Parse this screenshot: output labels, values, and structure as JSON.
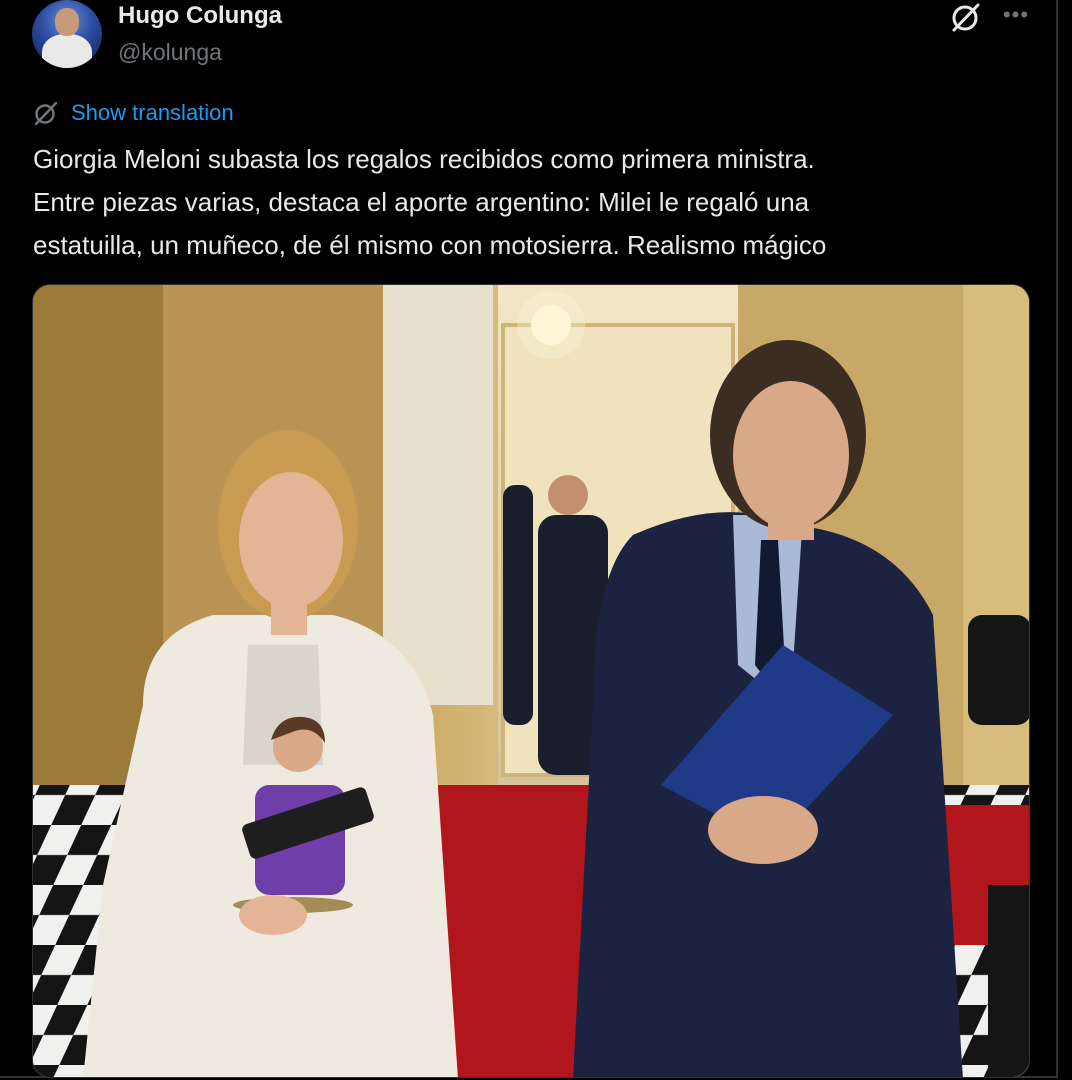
{
  "author": {
    "name": "Hugo Colunga",
    "handle": "@kolunga"
  },
  "icons": {
    "grok": "grok-icon",
    "more": "more-icon",
    "translate": "translate-icon"
  },
  "translation_link": "Show translation",
  "tweet_lines": [
    "Giorgia Meloni subasta los regalos recibidos como primera ministra.",
    "Entre piezas varias, destaca el aporte argentino: Milei le regaló una",
    "estatuilla, un muñeco, de él mismo con motosierra. Realismo mágico"
  ],
  "colors": {
    "background": "#000000",
    "text": "#e7e9ea",
    "secondary": "#71767b",
    "link": "#1d9bf0"
  }
}
